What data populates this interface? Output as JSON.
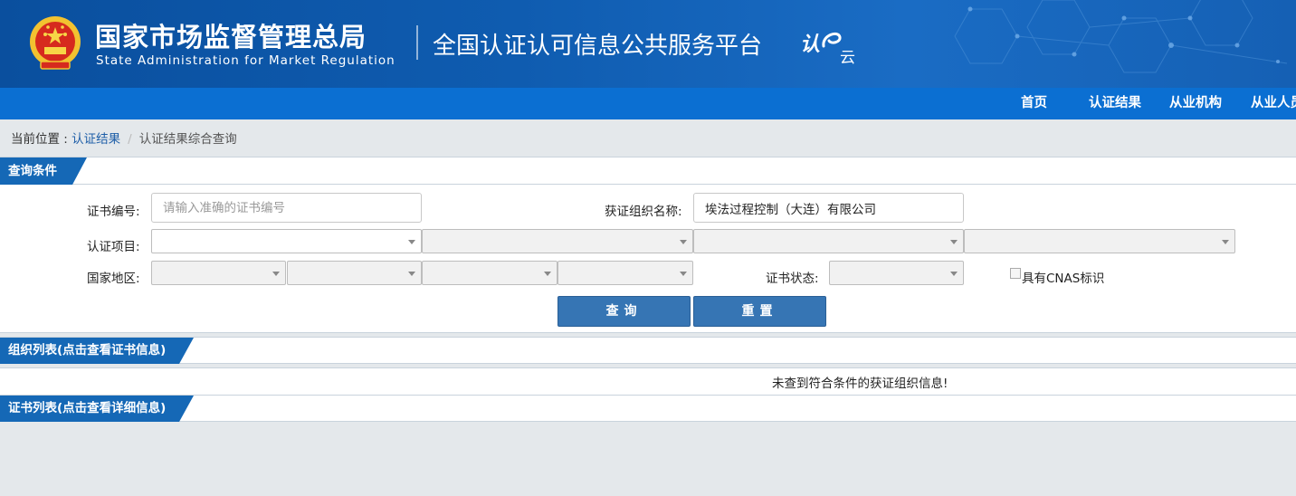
{
  "header": {
    "org_name_cn": "国家市场监督管理总局",
    "org_name_en": "State Administration  for  Market Regulation",
    "platform_title": "全国认证认可信息公共服务平台",
    "logo_text_1": "认",
    "logo_text_2": "云"
  },
  "nav": {
    "items": [
      {
        "label": "首页"
      },
      {
        "label": "认证结果"
      },
      {
        "label": "从业机构"
      },
      {
        "label": "从业人员"
      }
    ]
  },
  "breadcrumb": {
    "prefix": "当前位置 : ",
    "link": "认证结果",
    "separator": "/",
    "current": "认证结果综合查询"
  },
  "query_panel": {
    "title": "查询条件",
    "cert_no_label": "证书编号:",
    "cert_no_placeholder": "请输入准确的证书编号",
    "org_name_label": "获证组织名称:",
    "org_name_value": "埃法过程控制（大连）有限公司",
    "cert_item_label": "认证项目:",
    "region_label": "国家地区:",
    "status_label": "证书状态:",
    "cnas_label": "具有CNAS标识",
    "cnas_checked": false,
    "search_button": "查询",
    "reset_button": "重置"
  },
  "org_list": {
    "title": "组织列表(点击查看证书信息)",
    "empty_message": "未查到符合条件的获证组织信息!"
  },
  "cert_list": {
    "title": "证书列表(点击查看详细信息)"
  },
  "colors": {
    "banner": "#0f5cb0",
    "nav": "#0b6fd2",
    "tab": "#1568b6",
    "button": "#3675b4",
    "page_bg": "#e4e8eb"
  }
}
